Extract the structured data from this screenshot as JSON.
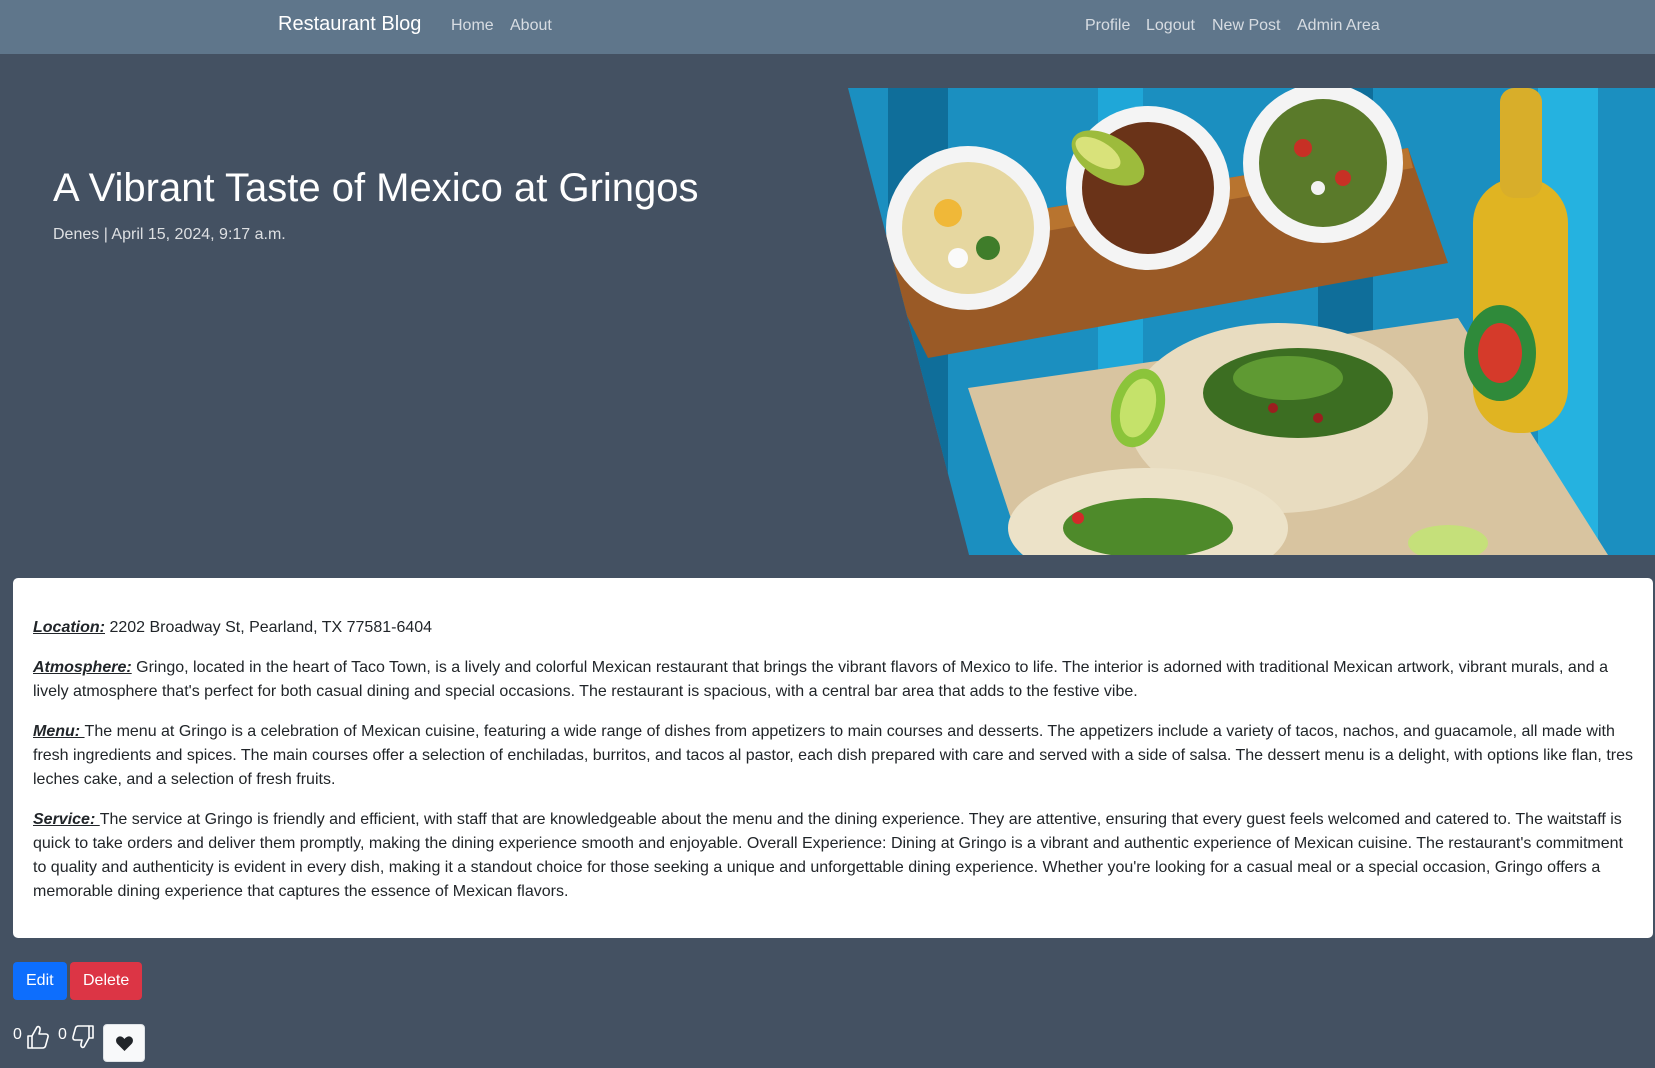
{
  "nav": {
    "brand": "Restaurant Blog",
    "left_links": [
      "Home",
      "About"
    ],
    "right_links": [
      "Profile",
      "Logout",
      "New Post",
      "Admin Area"
    ]
  },
  "post": {
    "title": "A Vibrant Taste of Mexico at Gringos",
    "meta": "Denes | April 15, 2024, 9:17 a.m.",
    "sections": [
      {
        "label": "Location:",
        "text": " 2202 Broadway St, Pearland, TX 77581-6404"
      },
      {
        "label": "Atmosphere:",
        "text": " Gringo, located in the heart of Taco Town, is a lively and colorful Mexican restaurant that brings the vibrant flavors of Mexico to life. The interior is adorned with traditional Mexican artwork, vibrant murals, and a lively atmosphere that's perfect for both casual dining and special occasions. The restaurant is spacious, with a central bar area that adds to the festive vibe."
      },
      {
        "label": "Menu: ",
        "text": "The menu at Gringo is a celebration of Mexican cuisine, featuring a wide range of dishes from appetizers to main courses and desserts. The appetizers include a variety of tacos, nachos, and guacamole, all made with fresh ingredients and spices. The main courses offer a selection of enchiladas, burritos, and tacos al pastor, each dish prepared with care and served with a side of salsa. The dessert menu is a delight, with options like flan, tres leches cake, and a selection of fresh fruits."
      },
      {
        "label": "Service: ",
        "text": "The service at Gringo is friendly and efficient, with staff that are knowledgeable about the menu and the dining experience. They are attentive, ensuring that every guest feels welcomed and catered to. The waitstaff is quick to take orders and deliver them promptly, making the dining experience smooth and enjoyable. Overall Experience: Dining at Gringo is a vibrant and authentic experience of Mexican cuisine. The restaurant's commitment to quality and authenticity is evident in every dish, making it a standout choice for those seeking a unique and unforgettable dining experience. Whether you're looking for a casual meal or a special occasion, Gringo offers a memorable dining experience that captures the essence of Mexican flavors."
      }
    ]
  },
  "actions": {
    "edit": "Edit",
    "delete": "Delete"
  },
  "reactions": {
    "likes": "0",
    "dislikes": "0"
  },
  "icons": {
    "like": "thumbs-up-icon",
    "dislike": "thumbs-down-icon",
    "favorite": "heart-icon"
  },
  "colors": {
    "page_bg": "#445162",
    "navbar_bg": "#5f768b",
    "edit_button": "#0d6efd",
    "delete_button": "#dc3545"
  }
}
